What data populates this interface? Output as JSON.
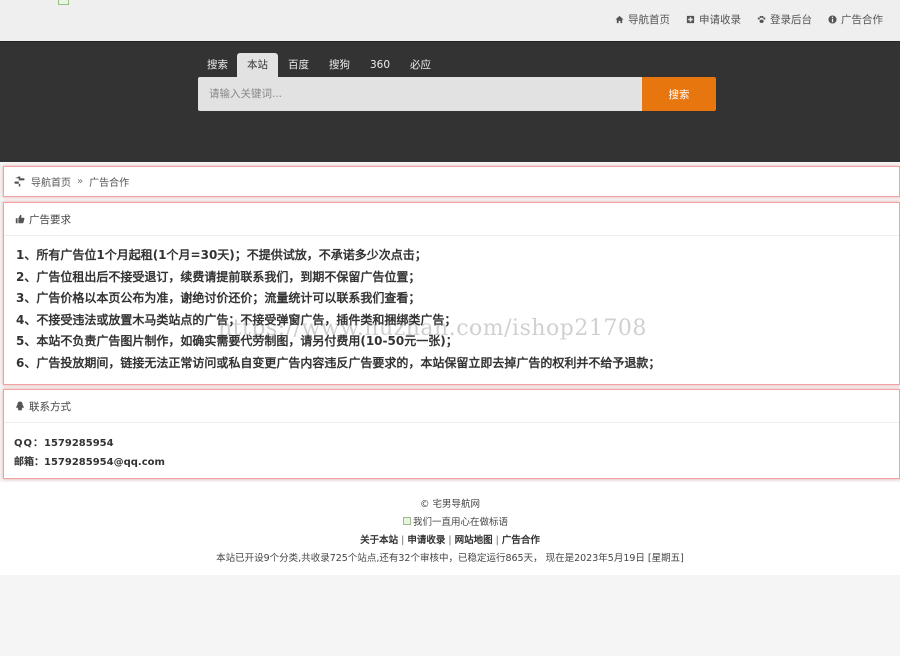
{
  "topnav": {
    "items": [
      {
        "label": "导航首页",
        "icon": "home-icon"
      },
      {
        "label": "申请收录",
        "icon": "plus-square-icon"
      },
      {
        "label": "登录后台",
        "icon": "paw-icon"
      },
      {
        "label": "广告合作",
        "icon": "info-circle-icon"
      }
    ]
  },
  "search": {
    "tabs": [
      "搜索",
      "本站",
      "百度",
      "搜狗",
      "360",
      "必应"
    ],
    "active_tab": "本站",
    "placeholder": "请输入关键词...",
    "button_label": "搜索"
  },
  "breadcrumb": {
    "home": "导航首页",
    "separator": "»",
    "current": "广告合作"
  },
  "requirements": {
    "title": "广告要求",
    "items": [
      "1、所有广告位1个月起租(1个月=30天)；不提供试放，不承诺多少次点击；",
      "2、广告位租出后不接受退订，续费请提前联系我们，到期不保留广告位置；",
      "3、广告价格以本页公布为准，谢绝讨价还价；流量统计可以联系我们查看；",
      "4、不接受违法或放置木马类站点的广告；不接受弹窗广告，插件类和捆绑类广告；",
      "5、本站不负责广告图片制作，如确实需要代劳制图，请另付费用(10-50元一张)；",
      "6、广告投放期间，链接无法正常访问或私自变更广告内容违反广告要求的，本站保留立即去掉广告的权利并不给予退款；"
    ]
  },
  "contact": {
    "title": "联系方式",
    "qq_label": "QQ：",
    "qq": "1579285954",
    "email_label": "邮箱：",
    "email": "1579285954@qq.com"
  },
  "watermark": "https://www.huzhan.com/ishop21708",
  "footer": {
    "copyright": "© 宅男导航网",
    "slogan_alt": "我们一直用心在做标语",
    "links": [
      "关于本站",
      "申请收录",
      "网站地图",
      "广告合作"
    ],
    "stats": "本站已开设9个分类,共收录725个站点,还有32个审核中，已稳定运行865天， 现在是2023年5月19日 [星期五]"
  },
  "colors": {
    "accent": "#e8760e",
    "hero_bg": "#333333",
    "card_border": "#f0a3a3"
  }
}
